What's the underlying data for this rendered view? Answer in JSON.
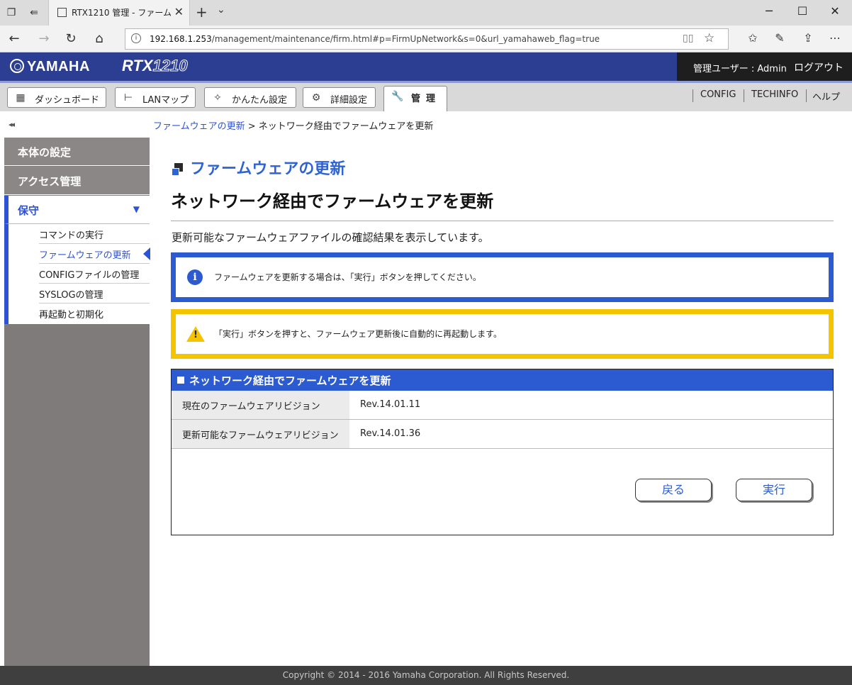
{
  "browser": {
    "tab_title": "RTX1210 管理 - ファームウ",
    "url_host": "192.168.1.253",
    "url_path": "/management/maintenance/firm.html#p=FirmUpNetwork&s=0&url_yamahaweb_flag=true"
  },
  "header": {
    "logo": "YAMAHA",
    "model_bold": "RTX",
    "model_light": "1210",
    "user": "管理ユーザー : Admin",
    "logout": "ログアウト"
  },
  "nav": {
    "tabs": [
      {
        "label": "ダッシュボード",
        "icon": "dashboard-icon"
      },
      {
        "label": "LANマップ",
        "icon": "lan-map-icon"
      },
      {
        "label": "かんたん設定",
        "icon": "wizard-icon"
      },
      {
        "label": "詳細設定",
        "icon": "gear-icon"
      },
      {
        "label": "管理",
        "icon": "wrench-icon"
      }
    ],
    "links": [
      "CONFIG",
      "TECHINFO",
      "ヘルプ"
    ]
  },
  "sidebar": {
    "collapse": "◂◂",
    "sections": [
      "本体の設定",
      "アクセス管理",
      "保守"
    ],
    "items": [
      "コマンドの実行",
      "ファームウェアの更新",
      "CONFIGファイルの管理",
      "SYSLOGの管理",
      "再起動と初期化"
    ]
  },
  "content": {
    "breadcrumb_link": "ファームウェアの更新",
    "breadcrumb_sep": " > ",
    "breadcrumb_current": "ネットワーク経由でファームウェアを更新",
    "section_title": "ファームウェアの更新",
    "page_title": "ネットワーク経由でファームウェアを更新",
    "description": "更新可能なファームウェアファイルの確認結果を表示しています。",
    "info_text": "ファームウェアを更新する場合は、「実行」ボタンを押してください。",
    "warning_text": "「実行」ボタンを押すと、ファームウェア更新後に自動的に再起動します。",
    "panel_title": "ネットワーク経由でファームウェアを更新",
    "rows": [
      {
        "label": "現在のファームウェアリビジョン",
        "value": "Rev.14.01.11"
      },
      {
        "label": "更新可能なファームウェアリビジョン",
        "value": "Rev.14.01.36"
      }
    ],
    "back_button": "戻る",
    "execute_button": "実行"
  },
  "footer": "Copyright © 2014 - 2016 Yamaha Corporation. All Rights Reserved.",
  "colors": {
    "header": "#2c3e91",
    "accent": "#2c5ad1",
    "warning": "#f5c400"
  }
}
